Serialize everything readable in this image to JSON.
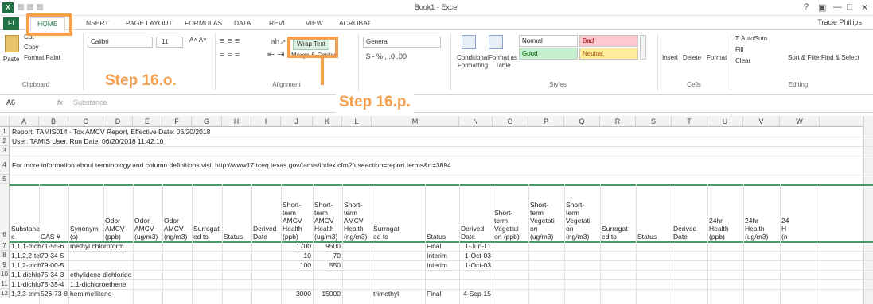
{
  "window": {
    "title": "Book1 - Excel",
    "user": "Tracie Phillips",
    "controls": [
      "?",
      "▣",
      "—",
      "□",
      "✕"
    ]
  },
  "tabs": {
    "file": "FI",
    "home": "HOME",
    "insert": "NSERT",
    "page_layout": "PAGE LAYOUT",
    "formulas": "FORMULAS",
    "data": "DATA",
    "review": "REVI",
    "view": "VIEW",
    "acrobat": "ACROBAT"
  },
  "clipboard": {
    "paste": "Paste",
    "cut": "Cut",
    "copy": "Copy",
    "format_painter": "Format Paint",
    "label": "Clipboard"
  },
  "font": {
    "name": "Calibri",
    "size": "11"
  },
  "alignment": {
    "wrap_text": "Wrap Text",
    "merge_center": "Merge & Center",
    "label": "Alignment"
  },
  "number": {
    "format": "General",
    "symbols": "$ - % ,   .0  .00"
  },
  "styles": {
    "conditional": "Conditional Formatting",
    "format_as_table": "Format as Table",
    "normal": "Normal",
    "bad": "Bad",
    "good": "Good",
    "neutral": "Neutral",
    "label": "Styles"
  },
  "cells": {
    "insert": "Insert",
    "delete": "Delete",
    "format": "Format",
    "label": "Cells"
  },
  "editing": {
    "autosum": "AutoSum",
    "fill": "Fill",
    "clear": "Clear",
    "sort_filter": "Sort & Filter",
    "find_select": "Find & Select",
    "label": "Editing"
  },
  "callouts": {
    "a": "Step 16.o.",
    "b": "Step 16.p."
  },
  "formula_bar": {
    "name_box": "A6",
    "fx": "fx",
    "content": "Substance"
  },
  "columns": [
    "A",
    "B",
    "C",
    "D",
    "E",
    "F",
    "G",
    "H",
    "I",
    "J",
    "K",
    "L",
    "M",
    "N",
    "O",
    "P",
    "Q",
    "R",
    "S",
    "T",
    "U",
    "V",
    "W"
  ],
  "row_numbers": [
    "1",
    "2",
    "3",
    "4",
    "5",
    "6",
    "7",
    "8",
    "9",
    "10",
    "11",
    "12"
  ],
  "rows_text": {
    "r1": "Report: TAMIS014 - Tox AMCV Report, Effective Date: 06/20/2018",
    "r2": "User: TAMIS User, Run Date: 06/20/2018 11:42:10",
    "r4": "For more information about terminology and column definitions visit http://www17.tceq.texas.gov/tamis/index.cfm?fuseaction=report.terms&rt=3894"
  },
  "headers": {
    "a": [
      "Substanc",
      "e"
    ],
    "b": "CAS #",
    "c": [
      "Synonym",
      "(s)"
    ],
    "d": [
      "Odor",
      "AMCV",
      "(ppb)"
    ],
    "e": [
      "Odor",
      "AMCV",
      "(ug/m3)"
    ],
    "f": [
      "Odor",
      "AMCV",
      "(ng/m3)"
    ],
    "g": [
      "Surrogat",
      "ed to"
    ],
    "h": "Status",
    "i": [
      "Derived",
      "Date"
    ],
    "j": [
      "Short-",
      "term",
      "AMCV",
      "Health",
      "(ppb)"
    ],
    "k": [
      "Short-",
      "term",
      "AMCV",
      "Health",
      "(ug/m3)"
    ],
    "l": [
      "Short-",
      "term",
      "AMCV",
      "Health",
      "(ng/m3)"
    ],
    "m": [
      "Surrogat",
      "ed to"
    ],
    "n": "Status",
    "o": [
      "Derived",
      "Date"
    ],
    "p": [
      "Short-",
      "term",
      "Vegetati",
      "on (ppb)"
    ],
    "q": [
      "Short-",
      "term",
      "Vegetati",
      "on",
      "(ug/m3)"
    ],
    "r": [
      "Short-",
      "term",
      "Vegetati",
      "on",
      "(ng/m3)"
    ],
    "s": [
      "Surrogat",
      "ed to"
    ],
    "t": "Status",
    "u": [
      "Derived",
      "Date"
    ],
    "v": [
      "24hr",
      "Health",
      "(ppb)"
    ],
    "w": [
      "24hr",
      "Health",
      "(ug/m3)"
    ],
    "x": [
      "24",
      "H",
      "(n"
    ]
  },
  "data_rows": [
    {
      "a": "1,1,1-trich",
      "b": "71-55-6",
      "c": "methyl chloroform",
      "j": "1700",
      "k": "9500",
      "m": "",
      "n": "Final",
      "o": "1-Jun-11"
    },
    {
      "a": "1,1,2,2-tet",
      "b": "79-34-5",
      "c": "",
      "j": "10",
      "k": "70",
      "m": "",
      "n": "Interim",
      "o": "1-Oct-03"
    },
    {
      "a": "1,1,2-trich",
      "b": "79-00-5",
      "c": "",
      "j": "100",
      "k": "550",
      "m": "",
      "n": "Interim",
      "o": "1-Oct-03"
    },
    {
      "a": "1,1-dichlo",
      "b": "75-34-3",
      "c": "ethylidene dichloride",
      "j": "",
      "k": "",
      "m": "",
      "n": "",
      "o": ""
    },
    {
      "a": "1,1-dichlo",
      "b": "75-35-4",
      "c": "1,1-dichloroethene",
      "j": "",
      "k": "",
      "m": "",
      "n": "",
      "o": ""
    },
    {
      "a": "1,2,3-trim",
      "b": "526-73-8",
      "c": "hemimellitene",
      "j": "3000",
      "k": "15000",
      "m": "trimethyl",
      "n": "Final",
      "o": "4-Sep-15"
    }
  ]
}
